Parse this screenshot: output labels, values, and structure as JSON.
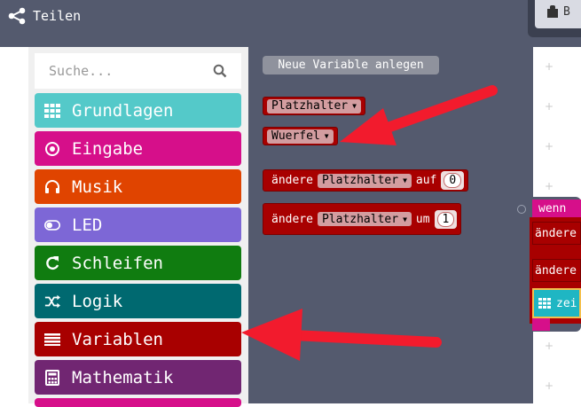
{
  "topbar": {
    "share_label": "Teilen",
    "right_button_label": "B"
  },
  "search": {
    "placeholder": "Suche..."
  },
  "categories": [
    {
      "label": "Grundlagen",
      "color": "#54c9c9",
      "icon": "grid-icon"
    },
    {
      "label": "Eingabe",
      "color": "#d60f8a",
      "icon": "target-icon"
    },
    {
      "label": "Musik",
      "color": "#e04400",
      "icon": "headphones-icon"
    },
    {
      "label": "LED",
      "color": "#7d67d6",
      "icon": "toggle-icon"
    },
    {
      "label": "Schleifen",
      "color": "#107c10",
      "icon": "refresh-icon"
    },
    {
      "label": "Logik",
      "color": "#006970",
      "icon": "shuffle-icon"
    },
    {
      "label": "Variablen",
      "color": "#a80000",
      "icon": "list-icon"
    },
    {
      "label": "Mathematik",
      "color": "#712672",
      "icon": "calculator-icon"
    }
  ],
  "flyout": {
    "new_variable_label": "Neue Variable anlegen",
    "variables": [
      "Platzhalter",
      "Wuerfel"
    ],
    "set_block": {
      "prefix": "ändere",
      "variable": "Platzhalter",
      "suffix": "auf",
      "value": "0"
    },
    "change_block": {
      "prefix": "ändere",
      "variable": "Platzhalter",
      "suffix": "um",
      "value": "1"
    }
  },
  "workspace": {
    "event_label": "wenn",
    "row1_label": "ändere",
    "row2_label": "ändere",
    "show_label": "zei"
  },
  "colors": {
    "topbar": "#545a6e",
    "flyout": "#545a6e",
    "variables": "#a80000",
    "arrow": "#f21b2d"
  }
}
